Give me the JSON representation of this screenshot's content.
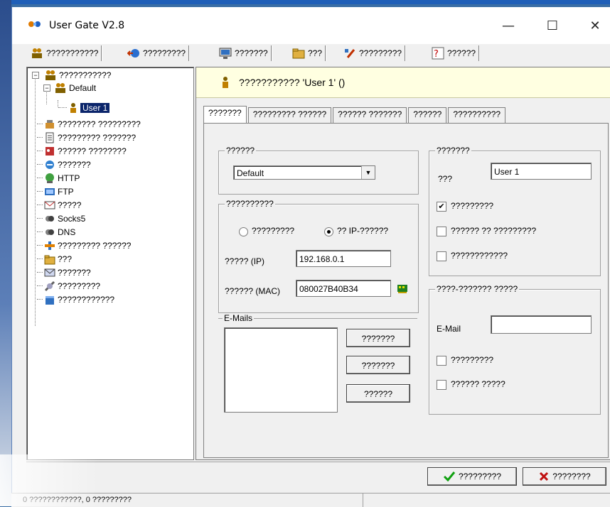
{
  "window": {
    "title": "User Gate V2.8",
    "minimize": "—",
    "maximize": "☐",
    "close": "✕"
  },
  "toolbar": {
    "items": [
      "???????????",
      "?????????",
      "???????",
      "???",
      "?????????",
      "??????"
    ]
  },
  "tree": {
    "root": "???????????",
    "group_default": "Default",
    "user_selected": "User 1",
    "items": [
      "???????? ?????????",
      "????????? ???????",
      "?????? ????????",
      "???????",
      "HTTP",
      "FTP",
      "?????",
      "Socks5",
      "DNS",
      "????????? ??????",
      "???",
      "???????",
      "?????????",
      "????????????"
    ]
  },
  "header": {
    "text": "??????????? 'User 1' ()"
  },
  "tabs": [
    "???????",
    "????????? ??????",
    "?????? ???????",
    "??????",
    "??????????"
  ],
  "group_box": {
    "label": "??????",
    "value": "Default"
  },
  "identify_box": {
    "label": "??????????",
    "radio1": "?????????",
    "radio2": "?? IP-??????",
    "ip_label": "????? (IP)",
    "ip_value": "192.168.0.1",
    "mac_label": "?????? (MAC)",
    "mac_value": "080027B40B34"
  },
  "emails_box": {
    "label": "E-Mails",
    "btn_add": "???????",
    "btn_edit": "???????",
    "btn_delete": "??????"
  },
  "profile_box": {
    "label": "???????",
    "name_label": "???",
    "name_value": "User 1",
    "check1": "?????????",
    "check2": "?????? ?? ?????????",
    "check3": "????????????"
  },
  "email_box": {
    "label": "????-??????? ?????",
    "email_label": "E-Mail",
    "email_value": "",
    "check1": "?????????",
    "check2": "?????? ?????"
  },
  "footer": {
    "ok": "?????????",
    "cancel": "????????"
  },
  "status": {
    "text": "0 ????????????, 0 ?????????"
  }
}
